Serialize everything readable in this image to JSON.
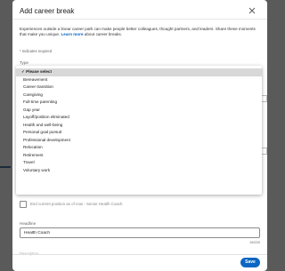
{
  "modal": {
    "title": "Add career break",
    "close_icon": "close-icon",
    "intro_text": "Experiences outside a linear career path can make people better colleagues, thought partners, and leaders. Share these moments that make you unique. ",
    "intro_link": "Learn more",
    "intro_suffix": " about career breaks.",
    "required_note": "* Indicates required",
    "type_label": "Type"
  },
  "dropdown": {
    "options": [
      {
        "label": "Please select",
        "selected": true
      },
      {
        "label": "Bereavement"
      },
      {
        "label": "Career transition"
      },
      {
        "label": "Caregiving"
      },
      {
        "label": "Full-time parenting"
      },
      {
        "label": "Gap year"
      },
      {
        "label": "Layoff/position eliminated"
      },
      {
        "label": "Health and well-being"
      },
      {
        "label": "Personal goal pursuit"
      },
      {
        "label": "Professional development"
      },
      {
        "label": "Relocation"
      },
      {
        "label": "Retirement"
      },
      {
        "label": "Travel"
      },
      {
        "label": "Voluntary work"
      }
    ],
    "check_mark": "✓"
  },
  "form": {
    "end_position_label": "End current position as of now - Senior Health Coach",
    "headline_label": "Headline",
    "headline_value": "Health Coach",
    "char_count": "26/220",
    "description_label": "Description"
  },
  "footer": {
    "save_label": "Save"
  },
  "colors": {
    "accent": "#0a66c2",
    "selected_bg": "#d8d8d8",
    "overlay": "#5a5a5a"
  }
}
